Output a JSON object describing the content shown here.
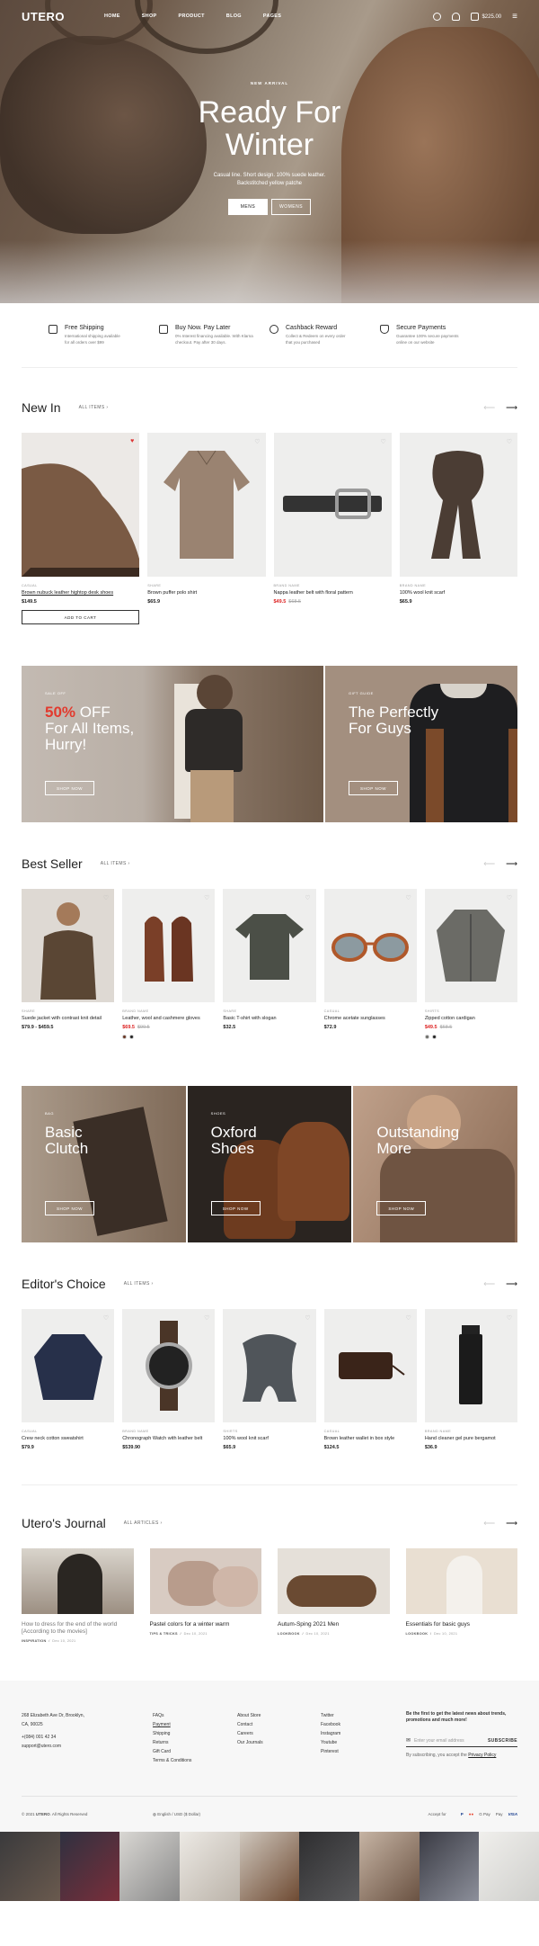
{
  "nav": {
    "logo": "UTERO",
    "menu": [
      "HOME",
      "SHOP",
      "PRODUCT",
      "BLOG",
      "PAGES"
    ],
    "cart_total": "$225.00"
  },
  "hero": {
    "kicker": "NEW ARRIVAL",
    "title_line1": "Ready For",
    "title_line2": "Winter",
    "sub_line1": "Casual line. Short design. 100% suede leather.",
    "sub_line2": "Backstitched yellow patche",
    "btn_mens": "MENS",
    "btn_womens": "WOMENS"
  },
  "features": [
    {
      "title": "Free Shipping",
      "text1": "International shipping available",
      "text2": "for all orders over $99"
    },
    {
      "title": "Buy Now. Pay Later",
      "text1": "0% Interest financing available. With Klarna",
      "text2": "checkout. Pay after 30 days."
    },
    {
      "title": "Cashback Reward",
      "text1": "Collect & Redeem on every order",
      "text2": "that you purchased"
    },
    {
      "title": "Secure Payments",
      "text1": "Guarantee 100% secure payments",
      "text2": "online on our website"
    }
  ],
  "new_in": {
    "title": "New In",
    "all": "ALL ITEMS",
    "add_to_cart": "ADD TO CART",
    "products": [
      {
        "brand": "CASUAL",
        "name": "Brown nubuck leather hightop desk shoes",
        "price": "$149.5",
        "old": ""
      },
      {
        "brand": "SHARE",
        "name": "Brown puffer polo shirt",
        "price": "$65.9",
        "old": ""
      },
      {
        "brand": "BRAND NAME",
        "name": "Nappa leather belt with floral pattern",
        "price": "$49.5",
        "old": "$68.5"
      },
      {
        "brand": "BRAND NAME",
        "name": "100% wool knit scarf",
        "price": "$65.9",
        "old": ""
      }
    ]
  },
  "promo1": {
    "tag": "SALE OFF",
    "pct": "50%",
    "off": " OFF",
    "line2": "For All Items,",
    "line3": "Hurry!",
    "btn": "SHOP NOW"
  },
  "promo2": {
    "tag": "GIFT GUIDE",
    "line1": "The Perfectly",
    "line2": "For Guys",
    "btn": "SHOP NOW"
  },
  "best": {
    "title": "Best Seller",
    "all": "ALL ITEMS",
    "products": [
      {
        "brand": "SHARE",
        "name": "Suede jacket with contrast knit detail",
        "price": "$79.9 - $459.5",
        "old": ""
      },
      {
        "brand": "BRAND NAME",
        "name": "Leather, wool and cashmere gloves",
        "price": "$69.5",
        "old": "$99.5"
      },
      {
        "brand": "SHARE",
        "name": "Basic T-shirt with slogan",
        "price": "$32.5",
        "old": ""
      },
      {
        "brand": "CASUAL",
        "name": "Chrome acetate sunglasses",
        "price": "$72.9",
        "old": ""
      },
      {
        "brand": "SHIRTS",
        "name": "Zipped cotton cardigan",
        "price": "$49.5",
        "old": "$68.5"
      }
    ]
  },
  "cats": [
    {
      "tag": "BAG",
      "l1": "Basic",
      "l2": "Clutch",
      "btn": "SHOP NOW"
    },
    {
      "tag": "SHOES",
      "l1": "Oxford",
      "l2": "Shoes",
      "btn": "SHOP NOW"
    },
    {
      "tag": "",
      "l1": "Outstanding",
      "l2": "More",
      "btn": "SHOP NOW"
    }
  ],
  "editor": {
    "title": "Editor's Choice",
    "all": "ALL ITEMS",
    "products": [
      {
        "brand": "CASUAL",
        "name": "Crew neck cotton sweatshirt",
        "price": "$79.9"
      },
      {
        "brand": "BRAND NAME",
        "name": "Chronograph Watch with leather belt",
        "price": "$539.90"
      },
      {
        "brand": "SHIRTS",
        "name": "100% wool knit scarf",
        "price": "$65.9"
      },
      {
        "brand": "CASUAL",
        "name": "Brown leather wallet in box style",
        "price": "$124.5"
      },
      {
        "brand": "BRAND NAME",
        "name": "Hand cleaner gel pure bergamot",
        "price": "$36.9"
      }
    ]
  },
  "journal": {
    "title": "Utero's Journal",
    "all": "ALL ARTICLES",
    "articles": [
      {
        "t1": "How to dress for the end of the world",
        "t2": "[According to the movies]",
        "cat": "INSPIRATION",
        "date": "Dec 10, 2021"
      },
      {
        "t1": "Pastel colors for a winter warm",
        "t2": "",
        "cat": "TIPS & TRICKS",
        "date": "Dec 10, 2021"
      },
      {
        "t1": "Autum-Sping 2021 Men",
        "t2": "",
        "cat": "LOOKBOOK",
        "date": "Dec 10, 2021"
      },
      {
        "t1": "Essentials for basic guys",
        "t2": "",
        "cat": "LOOKBOOK",
        "date": "Dec 10, 2021"
      }
    ]
  },
  "footer": {
    "address1": "268 Elizabeth Ave Dr, Brooklyn,",
    "address2": "CA, 90025",
    "phone": "+(084) 001 42 34",
    "email": "support@utero.com",
    "col1": [
      "FAQs",
      "Payment",
      "Shipping",
      "Returns",
      "Gift Card",
      "Terms & Conditions"
    ],
    "col2": [
      "About Store",
      "Contact",
      "Careers",
      "Our Journals"
    ],
    "col3": [
      "Twitter",
      "Facebook",
      "Instagram",
      "Youtube",
      "Pinterest"
    ],
    "news_title1": "Be the first to get the latest news about trends,",
    "news_title2": "promotions and much more!",
    "email_placeholder": "Enter your email address",
    "subscribe": "SUBSCRIBE",
    "terms_pre": "By subscribing, you accept the ",
    "terms_link": "Privacy Policy",
    "copyright_pre": "© 2021 ",
    "copyright_brand": "UTERO",
    "copyright_post": ". All Rights Reserved",
    "lang": "English / USD ($ Dollar)",
    "accept": "Accept for",
    "payments": [
      "P",
      "●●",
      "G Pay",
      "Pay",
      "VISA"
    ]
  }
}
